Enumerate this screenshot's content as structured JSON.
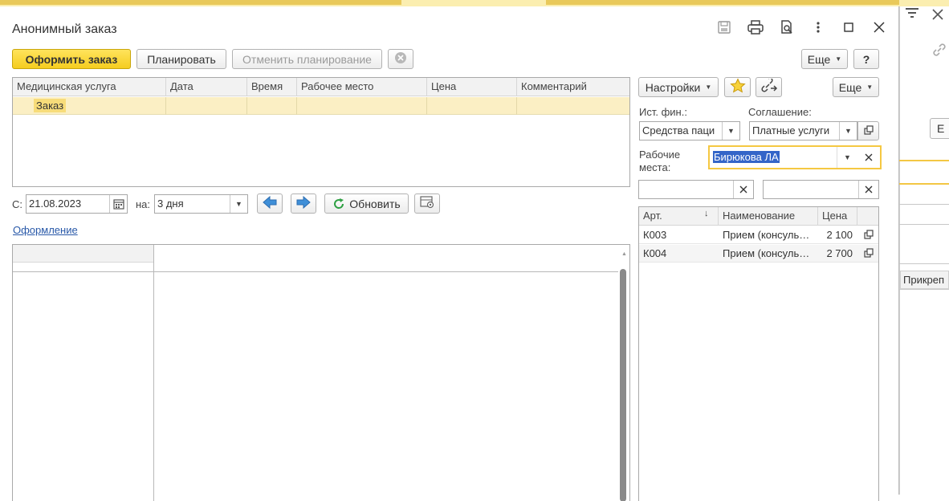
{
  "window": {
    "title": "Анонимный заказ"
  },
  "toolbar": {
    "create_order": "Оформить заказ",
    "plan": "Планировать",
    "cancel_plan": "Отменить планирование",
    "more": "Еще",
    "help": "?"
  },
  "orders_table": {
    "columns": [
      "Медицинская услуга",
      "Дата",
      "Время",
      "Рабочее место",
      "Цена",
      "Комментарий"
    ],
    "group_row": "Заказ"
  },
  "schedule": {
    "from_label": "С:",
    "from_date": "21.08.2023",
    "period_label": "на:",
    "period_value": "3 дня",
    "refresh": "Обновить",
    "design_link": "Оформление"
  },
  "right_panel": {
    "settings": "Настройки",
    "more": "Еще",
    "fin_source_label": "Ист. фин.:",
    "fin_source_value": "Средства паци",
    "agreement_label": "Соглашение:",
    "agreement_value": "Платные услуги",
    "workplace_label": "Рабочие места:",
    "workplace_value": "Бирюкова ЛА",
    "filter1": "",
    "filter2": ""
  },
  "services_table": {
    "columns": [
      "Арт.",
      "Наименование",
      "Цена"
    ],
    "rows": [
      {
        "art": "К003",
        "name": "Прием (консуль…",
        "price": "2 100"
      },
      {
        "art": "К004",
        "name": "Прием (консуль…",
        "price": "2 700"
      }
    ]
  },
  "background": {
    "column_header": "Прикреп",
    "button": "Е"
  }
}
